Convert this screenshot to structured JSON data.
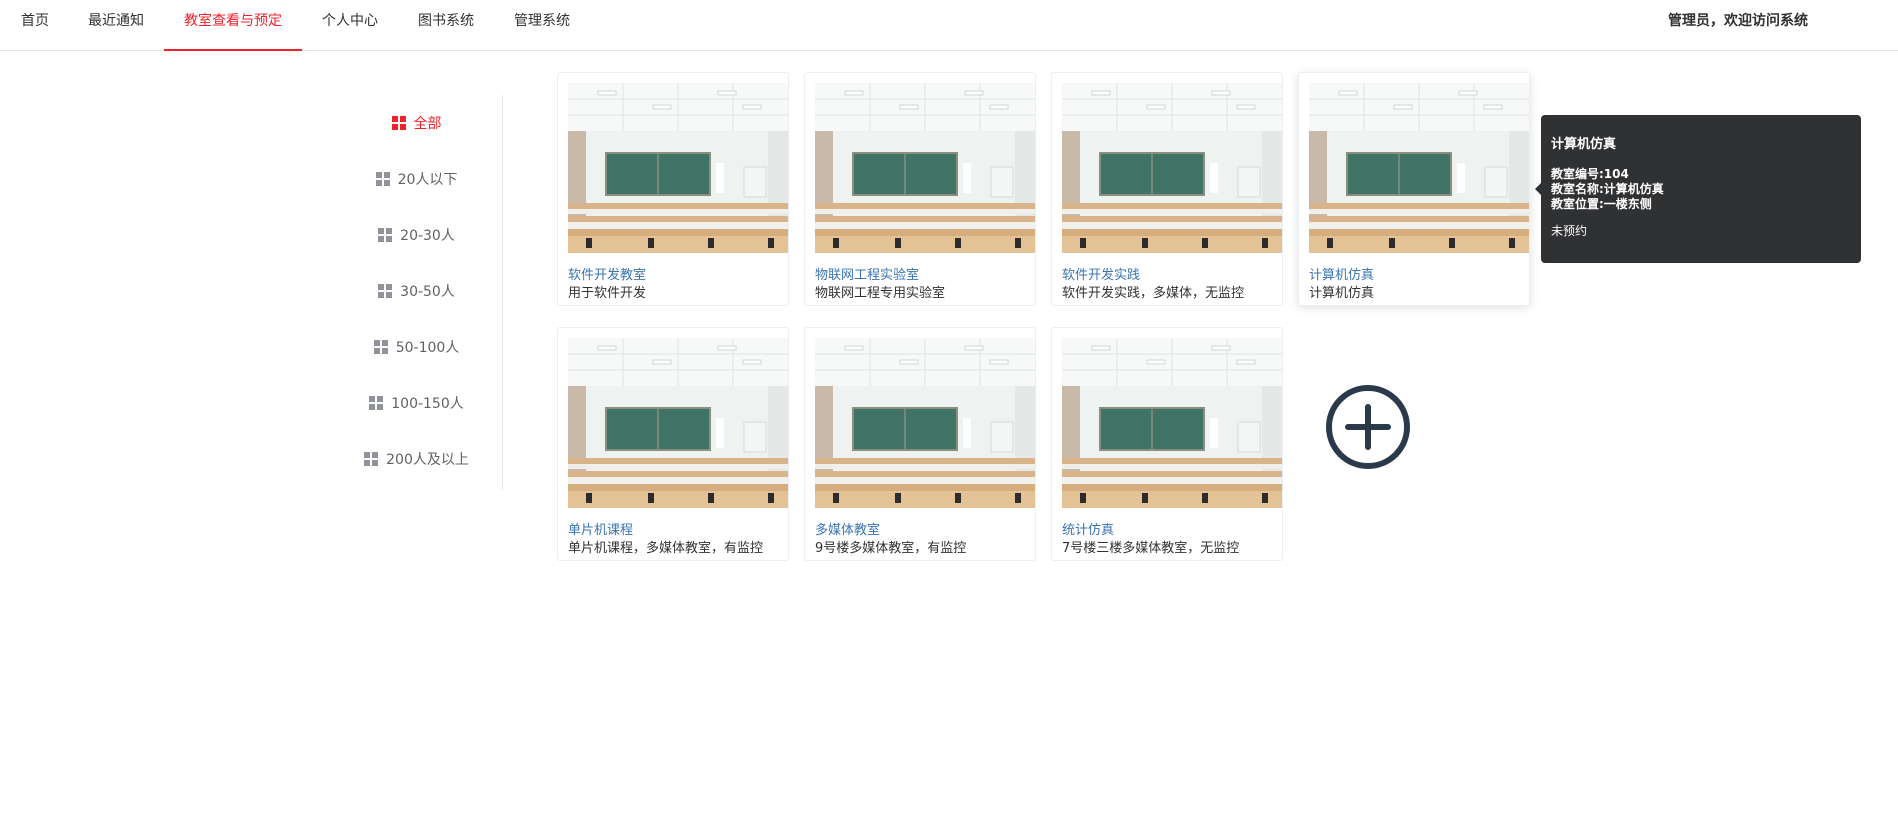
{
  "nav": {
    "items": [
      {
        "label": "首页",
        "active": false
      },
      {
        "label": "最近通知",
        "active": false
      },
      {
        "label": "教室查看与预定",
        "active": true
      },
      {
        "label": "个人中心",
        "active": false
      },
      {
        "label": "图书系统",
        "active": false
      },
      {
        "label": "管理系统",
        "active": false
      }
    ],
    "welcome": "管理员，欢迎访问系统"
  },
  "colors": {
    "accent": "#f2222c",
    "link": "#3a74b3",
    "tooltip_bg": "#303133",
    "add_icon": "#2b3a4a"
  },
  "filters": [
    {
      "label": "全部",
      "active": true
    },
    {
      "label": "20人以下",
      "active": false
    },
    {
      "label": "20-30人",
      "active": false
    },
    {
      "label": "30-50人",
      "active": false
    },
    {
      "label": "50-100人",
      "active": false
    },
    {
      "label": "100-150人",
      "active": false
    },
    {
      "label": "200人及以上",
      "active": false
    }
  ],
  "rooms": [
    {
      "title": "软件开发教室",
      "desc": "用于软件开发"
    },
    {
      "title": "物联网工程实验室",
      "desc": "物联网工程专用实验室"
    },
    {
      "title": "软件开发实践",
      "desc": "软件开发实践，多媒体，无监控"
    },
    {
      "title": "计算机仿真",
      "desc": "计算机仿真"
    },
    {
      "title": "单片机课程",
      "desc": "单片机课程，多媒体教室，有监控"
    },
    {
      "title": "多媒体教室",
      "desc": "9号楼多媒体教室，有监控"
    },
    {
      "title": "统计仿真",
      "desc": "7号楼三楼多媒体教室，无监控"
    }
  ],
  "add_button": {
    "icon": "plus-circle-icon"
  },
  "tooltip": {
    "title": "计算机仿真",
    "number": "教室编号:104",
    "name": "教室名称:计算机仿真",
    "location": "教室位置:一楼东侧",
    "status": "未预约"
  }
}
